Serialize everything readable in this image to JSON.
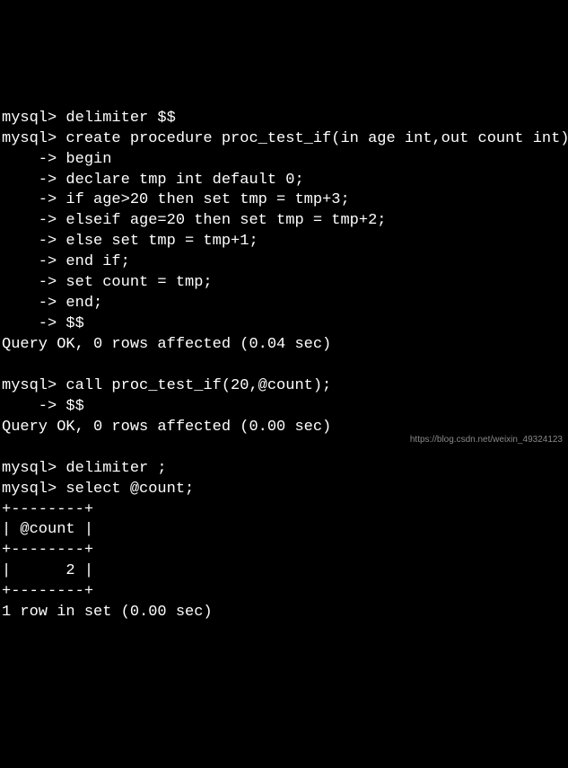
{
  "terminal": {
    "lines": [
      "mysql> delimiter $$",
      "mysql> create procedure proc_test_if(in age int,out count int)",
      "    -> begin",
      "    -> declare tmp int default 0;",
      "    -> if age>20 then set tmp = tmp+3;",
      "    -> elseif age=20 then set tmp = tmp+2;",
      "    -> else set tmp = tmp+1;",
      "    -> end if;",
      "    -> set count = tmp;",
      "    -> end;",
      "    -> $$",
      "Query OK, 0 rows affected (0.04 sec)",
      "",
      "mysql> call proc_test_if(20,@count);",
      "    -> $$",
      "Query OK, 0 rows affected (0.00 sec)",
      "",
      "mysql> delimiter ;",
      "mysql> select @count;",
      "+--------+",
      "| @count |",
      "+--------+",
      "|      2 |",
      "+--------+",
      "1 row in set (0.00 sec)"
    ]
  },
  "watermark": "https://blog.csdn.net/weixin_49324123"
}
